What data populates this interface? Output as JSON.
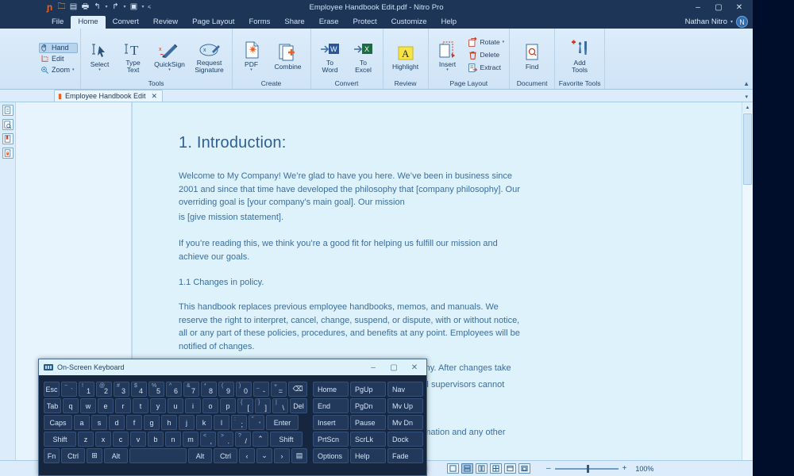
{
  "window": {
    "title": "Employee Handbook Edit.pdf - Nitro Pro",
    "minimize": "–",
    "maximize": "▢",
    "close": "✕"
  },
  "quick_access": [
    {
      "name": "nitro-logo-icon",
      "glyph": "ɲ"
    },
    {
      "name": "open-icon",
      "glyph": "🗀"
    },
    {
      "name": "save-icon",
      "glyph": "▤"
    },
    {
      "name": "print-icon",
      "glyph": "🖶"
    },
    {
      "name": "undo-icon",
      "glyph": "↰"
    },
    {
      "name": "undo-caret-icon",
      "glyph": "▾"
    },
    {
      "name": "redo-icon",
      "glyph": "↱"
    },
    {
      "name": "redo-caret-icon",
      "glyph": "▾"
    },
    {
      "name": "customize-icon",
      "glyph": "▣"
    },
    {
      "name": "customize-caret-icon",
      "glyph": "▾"
    },
    {
      "name": "more-icon",
      "glyph": "⩼"
    }
  ],
  "menu_tabs": [
    {
      "label": "File",
      "active": false
    },
    {
      "label": "Home",
      "active": true
    },
    {
      "label": "Convert",
      "active": false
    },
    {
      "label": "Review",
      "active": false
    },
    {
      "label": "Page Layout",
      "active": false
    },
    {
      "label": "Forms",
      "active": false
    },
    {
      "label": "Share",
      "active": false
    },
    {
      "label": "Erase",
      "active": false
    },
    {
      "label": "Protect",
      "active": false
    },
    {
      "label": "Customize",
      "active": false
    },
    {
      "label": "Help",
      "active": false
    }
  ],
  "account": {
    "name": "Nathan Nitro",
    "caret": "▾",
    "avatar_initial": "N"
  },
  "ribbon": {
    "collapse_caret": "▲",
    "modes": [
      {
        "label": "Hand",
        "icon": "✋",
        "selected": true
      },
      {
        "label": "Edit",
        "icon": "⛶",
        "selected": false
      },
      {
        "label": "Zoom",
        "icon": "🔍",
        "selected": false,
        "caret": "▾"
      }
    ],
    "groups": [
      {
        "name": "Tools",
        "label": "Tools",
        "buttons": [
          {
            "label": "Select",
            "icon": "select-cursor-icon",
            "caret": "▾"
          },
          {
            "label": "Type\nText",
            "icon": "type-text-icon",
            "caret": ""
          },
          {
            "label": "QuickSign",
            "icon": "quicksign-pen-icon",
            "caret": "▾"
          },
          {
            "label": "Request\nSignature",
            "icon": "request-signature-icon",
            "caret": ""
          }
        ]
      },
      {
        "name": "Create",
        "label": "Create",
        "buttons": [
          {
            "label": "PDF",
            "icon": "pdf-create-icon",
            "caret": "▾"
          },
          {
            "label": "Combine",
            "icon": "combine-icon",
            "caret": ""
          }
        ]
      },
      {
        "name": "Convert",
        "label": "Convert",
        "buttons": [
          {
            "label": "To\nWord",
            "icon": "to-word-icon",
            "caret": ""
          },
          {
            "label": "To\nExcel",
            "icon": "to-excel-icon",
            "caret": ""
          }
        ]
      },
      {
        "name": "Review",
        "label": "Review",
        "buttons": [
          {
            "label": "Highlight",
            "icon": "highlight-icon",
            "caret": ""
          }
        ]
      },
      {
        "name": "Page Layout",
        "label": "Page Layout",
        "buttons": [
          {
            "label": "Insert",
            "icon": "insert-page-icon",
            "caret": "▾"
          }
        ],
        "small_buttons": [
          {
            "label": "Rotate",
            "icon": "rotate-icon",
            "caret": "▾"
          },
          {
            "label": "Delete",
            "icon": "delete-page-icon",
            "caret": ""
          },
          {
            "label": "Extract",
            "icon": "extract-page-icon",
            "caret": ""
          }
        ]
      },
      {
        "name": "Document",
        "label": "Document",
        "buttons": [
          {
            "label": "Find",
            "icon": "find-icon",
            "caret": ""
          }
        ]
      },
      {
        "name": "Favorite Tools",
        "label": "Favorite Tools",
        "buttons": [
          {
            "label": "Add\nTools",
            "icon": "add-tools-icon",
            "caret": ""
          }
        ]
      }
    ]
  },
  "nav_rail": [
    {
      "name": "pages-panel-icon",
      "glyph": "▤"
    },
    {
      "name": "search-panel-icon",
      "glyph": "🔎"
    },
    {
      "name": "bookmarks-panel-icon",
      "glyph": "🔖"
    },
    {
      "name": "security-panel-icon",
      "glyph": "🔒"
    }
  ],
  "doc_tab": {
    "label": "Employee Handbook Edit",
    "close": "✕",
    "icon": "pdf-file-icon",
    "overflow_caret": "▾"
  },
  "document": {
    "heading": "1. Introduction:",
    "paragraphs": [
      "Welcome to My Company! We’re glad to have you here. We’ve been in business since 2001 and since that time have developed the philosophy that [company philosophy]. Our overriding goal is [your company’s main goal]. Our mission",
      "is [give mission statement].",
      "If you’re reading this, we think you’re a good fit for helping us fulfill our mission and achieve our goals.",
      "1.1 Changes in policy.",
      "This handbook replaces previous employee handbooks, memos, and manuals. We reserve the right to interpret, cancel, change, suspend, or dispute, with or without notice, all or any part of these policies, procedures, and benefits at any point. Employees will be notified of changes.",
      "e Company. After changes take",
      "agers and supervisors cannot",
      "tion information and any other"
    ]
  },
  "status_bar": {
    "prev_page": "◀",
    "next_page": "▶",
    "view_modes": [
      {
        "name": "single-page-view",
        "glyph": "▭",
        "selected": false
      },
      {
        "name": "continuous-view",
        "glyph": "⊟",
        "selected": true
      },
      {
        "name": "two-page-view",
        "glyph": "▯▯",
        "selected": false
      },
      {
        "name": "grid-view",
        "glyph": "⊞",
        "selected": false
      },
      {
        "name": "fit-page-view",
        "glyph": "⊡",
        "selected": false
      },
      {
        "name": "fit-width-view",
        "glyph": "⊡",
        "selected": false
      }
    ],
    "zoom_out": "–",
    "zoom_in": "+",
    "zoom_percent": "100%"
  },
  "osk": {
    "title": "On-Screen Keyboard",
    "minimize": "–",
    "maximize": "▢",
    "close": "✕",
    "rows": [
      [
        {
          "label": "Esc",
          "w": "w15"
        },
        {
          "sup": "~",
          "sub": "`",
          "w": "w1",
          "dim": true
        },
        {
          "sup": "!",
          "sub": "1",
          "w": "w1"
        },
        {
          "sup": "@",
          "sub": "2",
          "w": "w1"
        },
        {
          "sup": "#",
          "sub": "3",
          "w": "w1"
        },
        {
          "sup": "$",
          "sub": "4",
          "w": "w1"
        },
        {
          "sup": "%",
          "sub": "5",
          "w": "w1"
        },
        {
          "sup": "^",
          "sub": "6",
          "w": "w1"
        },
        {
          "sup": "&",
          "sub": "7",
          "w": "w1"
        },
        {
          "sup": "*",
          "sub": "8",
          "w": "w1"
        },
        {
          "sup": "(",
          "sub": "9",
          "w": "w1"
        },
        {
          "sup": ")",
          "sub": "0",
          "w": "w1"
        },
        {
          "sup": "_",
          "sub": "-",
          "w": "w1"
        },
        {
          "sup": "+",
          "sub": "=",
          "w": "w1"
        },
        {
          "label": "⌫",
          "w": "w25"
        }
      ],
      [
        {
          "label": "Tab",
          "w": "w15"
        },
        {
          "label": "q",
          "w": "w1"
        },
        {
          "label": "w",
          "w": "w1"
        },
        {
          "label": "e",
          "w": "w1"
        },
        {
          "label": "r",
          "w": "w1"
        },
        {
          "label": "t",
          "w": "w1"
        },
        {
          "label": "y",
          "w": "w1"
        },
        {
          "label": "u",
          "w": "w1"
        },
        {
          "label": "i",
          "w": "w1"
        },
        {
          "label": "o",
          "w": "w1"
        },
        {
          "label": "p",
          "w": "w1"
        },
        {
          "sup": "{",
          "sub": "[",
          "w": "w1"
        },
        {
          "sup": "}",
          "sub": "]",
          "w": "w1"
        },
        {
          "sup": "|",
          "sub": "\\",
          "w": "w1"
        },
        {
          "label": "Del",
          "w": "w15"
        }
      ],
      [
        {
          "label": "Caps",
          "w": "w18"
        },
        {
          "label": "a",
          "w": "w1"
        },
        {
          "label": "s",
          "w": "w1"
        },
        {
          "label": "d",
          "w": "w1"
        },
        {
          "label": "f",
          "w": "w1"
        },
        {
          "label": "g",
          "w": "w1"
        },
        {
          "label": "h",
          "w": "w1"
        },
        {
          "label": "j",
          "w": "w1"
        },
        {
          "label": "k",
          "w": "w1"
        },
        {
          "label": "l",
          "w": "w1"
        },
        {
          "sup": ":",
          "sub": ";",
          "w": "w1"
        },
        {
          "sup": "\"",
          "sub": "'",
          "w": "w1"
        },
        {
          "label": "Enter",
          "w": "w2"
        }
      ],
      [
        {
          "label": "Shift",
          "w": "w2"
        },
        {
          "label": "z",
          "w": "w1"
        },
        {
          "label": "x",
          "w": "w1"
        },
        {
          "label": "c",
          "w": "w1"
        },
        {
          "label": "v",
          "w": "w1"
        },
        {
          "label": "b",
          "w": "w1"
        },
        {
          "label": "n",
          "w": "w1"
        },
        {
          "label": "m",
          "w": "w1"
        },
        {
          "sup": "<",
          "sub": ",",
          "w": "w1"
        },
        {
          "sup": ">",
          "sub": ".",
          "w": "w1"
        },
        {
          "sup": "?",
          "sub": "/",
          "w": "w1"
        },
        {
          "label": "⌃",
          "w": "w1"
        },
        {
          "label": "Shift",
          "w": "w2"
        }
      ],
      [
        {
          "label": "Fn",
          "w": "w1"
        },
        {
          "label": "Ctrl",
          "w": "w15"
        },
        {
          "label": "⊞",
          "w": "w1"
        },
        {
          "label": "Alt",
          "w": "w15"
        },
        {
          "label": "",
          "w": "wspace"
        },
        {
          "label": "Alt",
          "w": "w15"
        },
        {
          "label": "Ctrl",
          "w": "w15"
        },
        {
          "label": "‹",
          "w": "w1"
        },
        {
          "label": "⌄",
          "w": "w1"
        },
        {
          "label": "›",
          "w": "w1"
        },
        {
          "label": "▤",
          "w": "w1"
        }
      ]
    ],
    "nav_columns": [
      [
        "Home",
        "End",
        "Insert",
        "PrtScn",
        "Options"
      ],
      [
        "PgUp",
        "PgDn",
        "Pause",
        "ScrLk",
        "Help"
      ],
      [
        "Nav",
        "Mv Up",
        "Mv Dn",
        "Dock",
        "Fade"
      ]
    ]
  },
  "colors": {
    "desktop": "#010e2b",
    "chrome_dark": "#1d3557",
    "ribbon_light": "#dcecfa",
    "page_bg": "#ddf2fb",
    "doc_text": "#3c6e9e",
    "accent_orange": "#e8622b",
    "key_bg": "#22395c"
  }
}
